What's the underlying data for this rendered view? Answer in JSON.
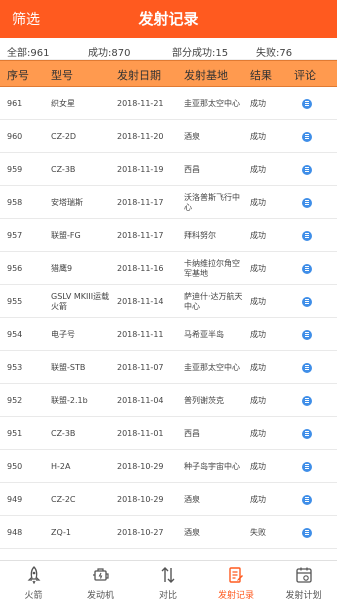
{
  "header": {
    "filter_label": "筛选",
    "title": "发射记录"
  },
  "stats": {
    "total": "全部:961",
    "success": "成功:870",
    "partial": "部分成功:15",
    "failure": "失败:76"
  },
  "columns": [
    "序号",
    "型号",
    "发射日期",
    "发射基地",
    "结果",
    "评论"
  ],
  "rows": [
    {
      "id": "961",
      "model": "织女星",
      "date": "2018-11-21",
      "base": "圭亚那太空中心",
      "result": "成功"
    },
    {
      "id": "960",
      "model": "CZ-2D",
      "date": "2018-11-20",
      "base": "酒泉",
      "result": "成功"
    },
    {
      "id": "959",
      "model": "CZ-3B",
      "date": "2018-11-19",
      "base": "西昌",
      "result": "成功"
    },
    {
      "id": "958",
      "model": "安塔瑞斯",
      "date": "2018-11-17",
      "base": "沃洛普斯飞行中心",
      "result": "成功"
    },
    {
      "id": "957",
      "model": "联盟-FG",
      "date": "2018-11-17",
      "base": "拜科努尔",
      "result": "成功"
    },
    {
      "id": "956",
      "model": "猎鹰9",
      "date": "2018-11-16",
      "base": "卡纳维拉尔角空军基地",
      "result": "成功"
    },
    {
      "id": "955",
      "model": "GSLV MKIII运载火箭",
      "date": "2018-11-14",
      "base": "萨迪什·达万航天中心",
      "result": "成功"
    },
    {
      "id": "954",
      "model": "电子号",
      "date": "2018-11-11",
      "base": "马希亚半岛",
      "result": "成功"
    },
    {
      "id": "953",
      "model": "联盟-STB",
      "date": "2018-11-07",
      "base": "圭亚那太空中心",
      "result": "成功"
    },
    {
      "id": "952",
      "model": "联盟-2.1b",
      "date": "2018-11-04",
      "base": "普列谢茨克",
      "result": "成功"
    },
    {
      "id": "951",
      "model": "CZ-3B",
      "date": "2018-11-01",
      "base": "西昌",
      "result": "成功"
    },
    {
      "id": "950",
      "model": "H-2A",
      "date": "2018-10-29",
      "base": "种子岛宇宙中心",
      "result": "成功"
    },
    {
      "id": "949",
      "model": "CZ-2C",
      "date": "2018-10-29",
      "base": "酒泉",
      "result": "成功"
    },
    {
      "id": "948",
      "model": "ZQ-1",
      "date": "2018-10-27",
      "base": "酒泉",
      "result": "失败"
    }
  ],
  "tabs": [
    {
      "label": "火箭",
      "icon": "rocket-icon"
    },
    {
      "label": "发动机",
      "icon": "engine-icon"
    },
    {
      "label": "对比",
      "icon": "compare-icon"
    },
    {
      "label": "发射记录",
      "icon": "launch-record-icon",
      "active": true
    },
    {
      "label": "发射计划",
      "icon": "launch-plan-icon"
    }
  ],
  "colors": {
    "primary": "#ff5a1f",
    "table_header": "#ff9a4f",
    "comment_icon": "#3f8ee8"
  }
}
